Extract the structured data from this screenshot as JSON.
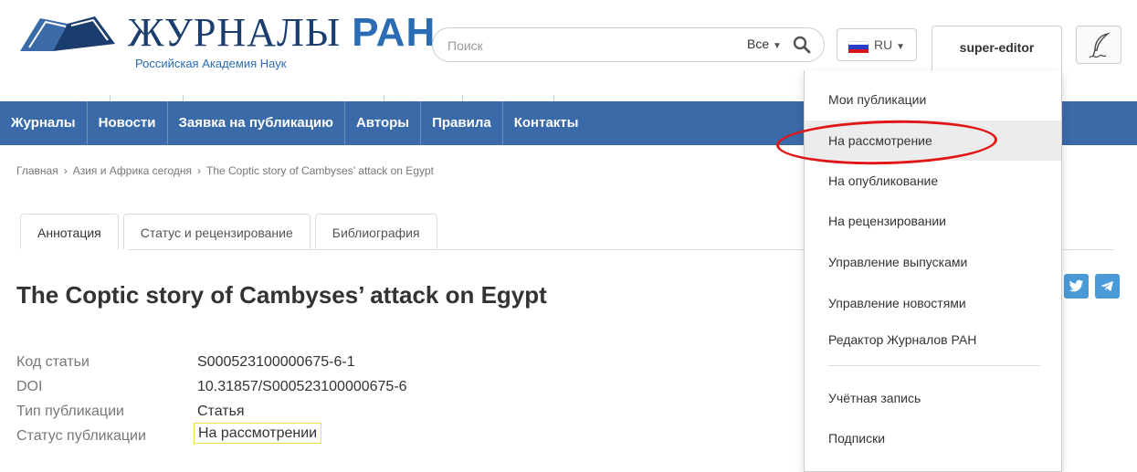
{
  "header": {
    "logo_title": "ЖУРНАЛЫ",
    "logo_title_accent": "РАН",
    "logo_subtitle": "Российская Академия Наук",
    "search_placeholder": "Поиск",
    "search_scope": "Все",
    "language": "RU",
    "username": "super-editor",
    "icons": [
      "book-logo-icon",
      "search-icon",
      "russian-flag-icon",
      "quill-icon"
    ]
  },
  "nav": {
    "items": [
      "Журналы",
      "Новости",
      "Заявка на публикацию",
      "Авторы",
      "Правила",
      "Контакты"
    ]
  },
  "breadcrumb": [
    "Главная",
    "Азия и Африка сегодня",
    "The Coptic story of Cambyses’ attack on Egypt"
  ],
  "tabs": [
    "Аннотация",
    "Статус и рецензирование",
    "Библиография"
  ],
  "article": {
    "title": "The Coptic story of Cambyses’ attack on Egypt",
    "meta": [
      {
        "label": "Код статьи",
        "value": "S000523100000675-6-1"
      },
      {
        "label": "DOI",
        "value": "10.31857/S000523100000675-6"
      },
      {
        "label": "Тип публикации",
        "value": "Статья"
      },
      {
        "label": "Статус публикации",
        "value": "На рассмотрении"
      }
    ]
  },
  "user_menu": {
    "items": [
      "Мои публикации",
      "На рассмотрение",
      "На опубликование",
      "На рецензировании",
      "Управление выпусками",
      "Управление новостями",
      "Редактор Журналов РАН"
    ],
    "account_items": [
      "Учётная запись",
      "Подписки"
    ],
    "highlighted": "На рассмотрение"
  },
  "colors": {
    "nav_bg": "#3a6aa8",
    "brand": "#2b6cb5",
    "annotation_circle": "#e01616",
    "status_badge_border": "#f0e050"
  }
}
